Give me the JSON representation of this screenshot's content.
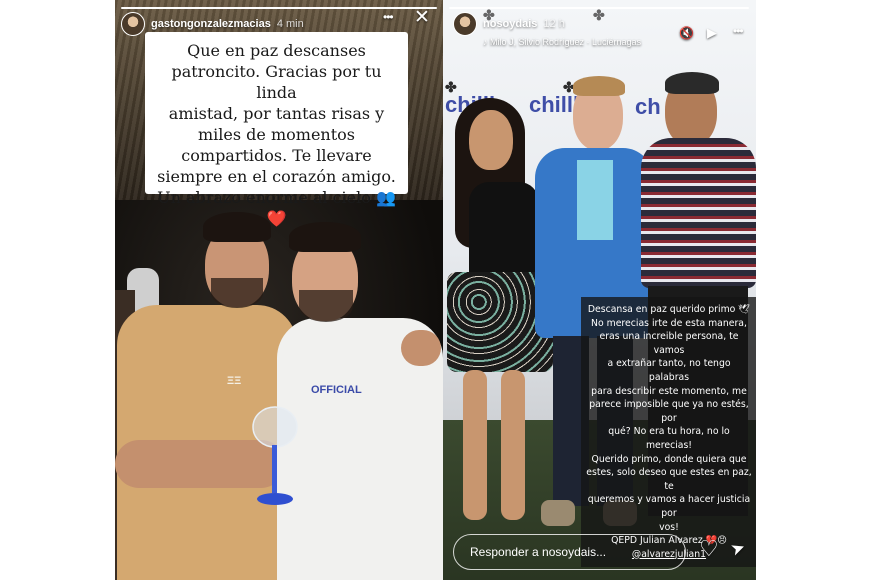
{
  "left_story": {
    "username": "gastongonzalezmacias",
    "time": "4 min",
    "progress": 1.0,
    "caption_lines": [
      "Que en paz descanses",
      "patroncito. Gracias por tu linda",
      "amistad, por tantas risas y",
      "miles de momentos",
      "compartidos. Te llevare",
      "siempre en el corazón amigo.",
      "Un abrazo enorme al cielo 👥❤️"
    ],
    "shirt_text": "OFFICIAL",
    "shirt_logo": "ΞΞ"
  },
  "right_story": {
    "username": "nosoydais",
    "time": "12 h",
    "music": "♪ Milo J, Silvio Rodríguez · Luciérnagas",
    "progress": 1.0,
    "brand_word": "chillb",
    "brand_word_2": "chillb",
    "brand_word_3": "ch",
    "overlay_lines": [
      "Descansa en paz querido primo 🕊",
      "No merecias irte de esta manera,",
      "eras una increible persona, te vamos",
      "a extrañar tanto, no tengo palabras",
      "para describir este momento, me",
      "parece imposible que ya no estés,  por",
      "qué? No era tu hora, no lo merecias!",
      "Querido primo, donde quiera que",
      "estes, solo deseo que estes en paz, te",
      "queremos y vamos a hacer justicia por",
      "vos!",
      "QEPD Julian Alvarez 💔😣"
    ],
    "mention": "@alvarezjulian1",
    "reply_placeholder": "Responder a nosoydais..."
  },
  "icons": {
    "more": "•••",
    "close": "✕",
    "mute": "🔇",
    "play": "▶",
    "heart": "♡",
    "send": "➤"
  }
}
